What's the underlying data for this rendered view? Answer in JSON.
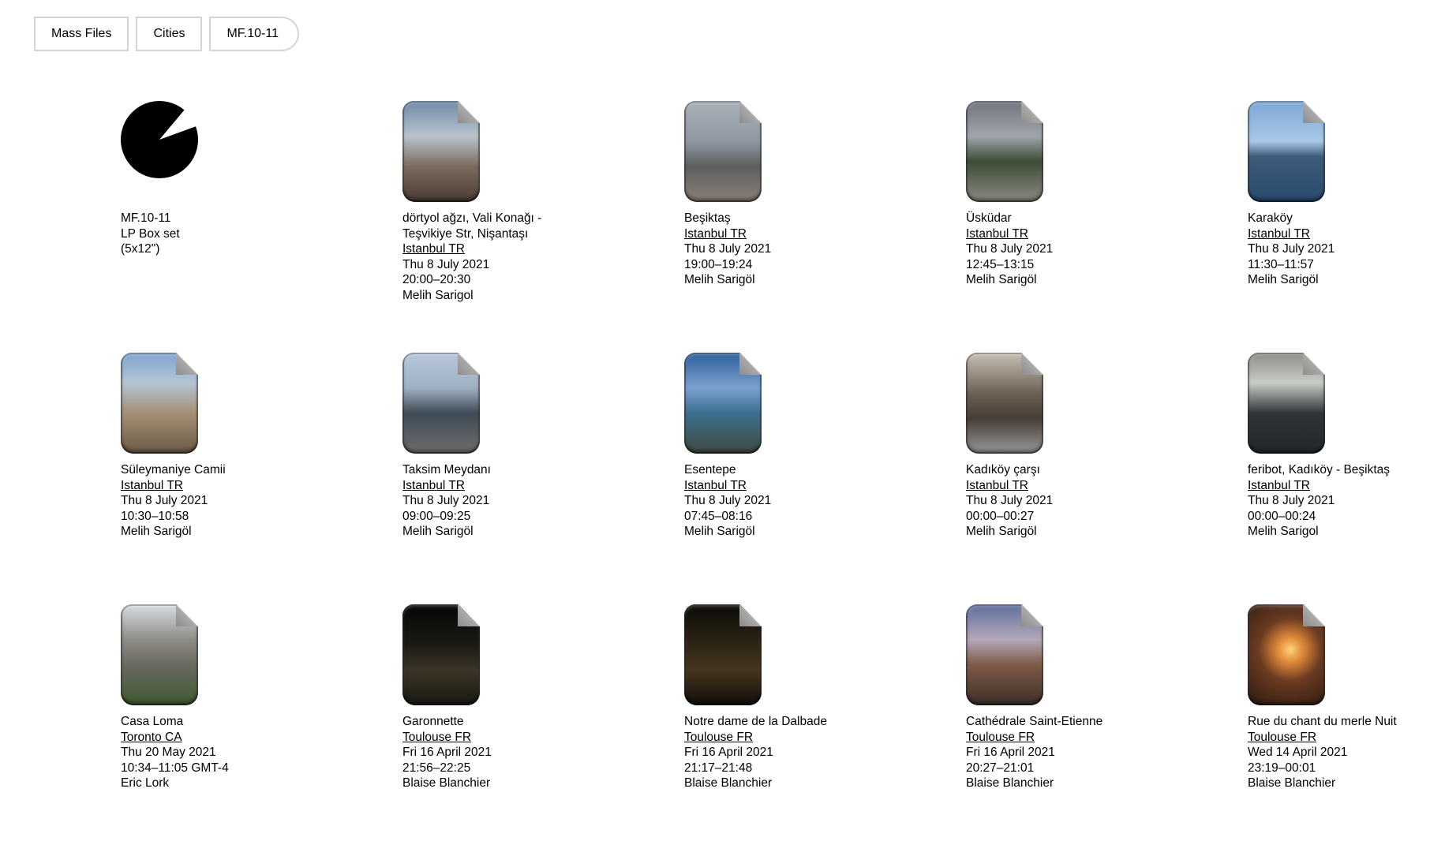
{
  "breadcrumb": [
    "Mass Files",
    "Cities",
    "MF.10-11"
  ],
  "album": {
    "lines": [
      "MF.10-11",
      "LP Box set",
      "(5x12\")"
    ]
  },
  "items": [
    {
      "title": "dörtyol ağzı, Vali Konağı - Teşvikiye Str, Nişantaşı",
      "location": "Istanbul TR",
      "date": "Thu 8 July 2021",
      "time": "20:00–20:30",
      "author": "Melih Sarigol"
    },
    {
      "title": "Beşiktaş",
      "location": "Istanbul TR",
      "date": "Thu 8 July 2021",
      "time": "19:00–19:24",
      "author": "Melih Sarigöl"
    },
    {
      "title": "Üsküdar",
      "location": "Istanbul TR",
      "date": "Thu 8 July 2021",
      "time": "12:45–13:15",
      "author": "Melih Sarigöl"
    },
    {
      "title": "Karaköy",
      "location": "Istanbul TR",
      "date": "Thu 8 July 2021",
      "time": "11:30–11:57",
      "author": "Melih Sarigöl"
    },
    {
      "title": "Süleymaniye Camii",
      "location": "Istanbul TR",
      "date": "Thu 8 July 2021",
      "time": "10:30–10:58",
      "author": "Melih Sarigöl"
    },
    {
      "title": "Taksim Meydanı",
      "location": "Istanbul TR",
      "date": "Thu 8 July 2021",
      "time": "09:00–09:25",
      "author": "Melih Sarigöl"
    },
    {
      "title": "Esentepe",
      "location": "Istanbul TR",
      "date": "Thu 8 July 2021",
      "time": "07:45–08:16",
      "author": "Melih Sarigöl"
    },
    {
      "title": "Kadıköy çarşı",
      "location": "Istanbul TR",
      "date": "Thu 8 July 2021",
      "time": "00:00–00:27",
      "author": "Melih Sarigöl"
    },
    {
      "title": "feribot, Kadıköy - Beşiktaş",
      "location": "Istanbul TR",
      "date": "Thu 8 July 2021",
      "time": "00:00–00:24",
      "author": "Melih Sarigol"
    },
    {
      "title": "Casa Loma",
      "location": "Toronto CA",
      "date": "Thu 20 May 2021",
      "time": "10:34–11:05 GMT-4",
      "author": "Eric Lork"
    },
    {
      "title": "Garonnette",
      "location": "Toulouse FR",
      "date": "Fri 16 April 2021",
      "time": "21:56–22:25",
      "author": "Blaise Blanchier"
    },
    {
      "title": "Notre dame de la Dalbade",
      "location": "Toulouse FR",
      "date": "Fri 16 April 2021",
      "time": "21:17–21:48",
      "author": "Blaise Blanchier"
    },
    {
      "title": "Cathédrale Saint-Etienne",
      "location": "Toulouse FR",
      "date": "Fri 16 April 2021",
      "time": "20:27–21:01",
      "author": "Blaise Blanchier"
    },
    {
      "title": "Rue du chant du merle Nuit",
      "location": "Toulouse FR",
      "date": "Wed 14 April 2021",
      "time": "23:19–00:01",
      "author": "Blaise Blanchier"
    }
  ]
}
